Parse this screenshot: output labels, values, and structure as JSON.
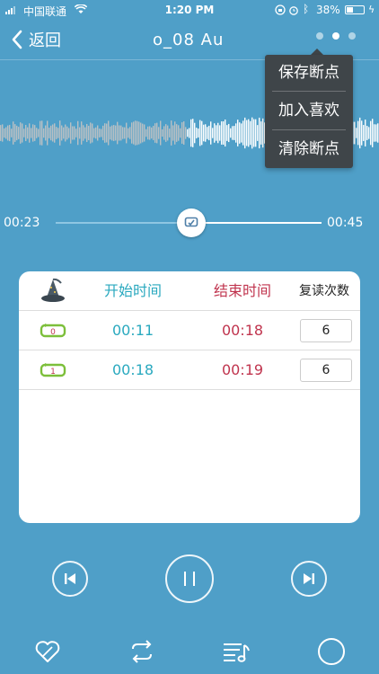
{
  "status_bar": {
    "carrier": "中国联通",
    "time": "1:20 PM",
    "battery_percent": "38%"
  },
  "nav": {
    "back_label": "返回",
    "title": "o_08   Au",
    "pages": 3,
    "active_page": 2
  },
  "menu": {
    "items": [
      {
        "label": "保存断点"
      },
      {
        "label": "加入喜欢"
      },
      {
        "label": "清除断点"
      }
    ]
  },
  "player": {
    "current_time": "00:23",
    "total_time": "00:45",
    "progress_fraction": 0.51
  },
  "repeat_table": {
    "header": {
      "start": "开始时间",
      "end": "结束时间",
      "count": "复读次数"
    },
    "rows": [
      {
        "index": "0",
        "start": "00:11",
        "end": "00:18",
        "count": "6"
      },
      {
        "index": "1",
        "start": "00:18",
        "end": "00:19",
        "count": "6"
      }
    ]
  },
  "colors": {
    "background": "#4f9fc8",
    "start_time": "#2aa9bf",
    "end_time": "#c0344e",
    "menu_bg": "#3f4549"
  },
  "icons": {
    "header": "wizard-hat-icon",
    "row": "repeat-loop-icon",
    "bottom": [
      "heart-icon",
      "loop-icon",
      "playlist-icon",
      "circle-icon"
    ]
  }
}
